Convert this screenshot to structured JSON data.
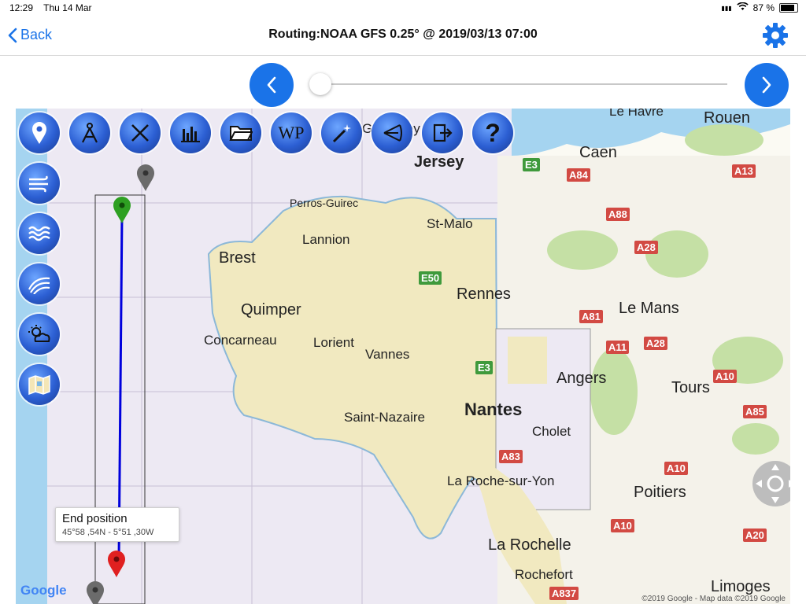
{
  "status": {
    "time": "12:29",
    "date": "Thu 14 Mar",
    "battery": "87 %",
    "battery_level": 0.87
  },
  "nav": {
    "back_label": "Back",
    "title": "Routing:NOAA GFS 0.25° @ 2019/03/13 07:00"
  },
  "timeline": {
    "slider_position": 0.0
  },
  "map": {
    "labels": {
      "le_havre": "Le Havre",
      "rouen": "Rouen",
      "caen": "Caen",
      "jersey": "Jersey",
      "guernsey": "Guernsey",
      "perros": "Perros-Guirec",
      "st_malo": "St-Malo",
      "lannion": "Lannion",
      "brest": "Brest",
      "rennes": "Rennes",
      "le_mans": "Le Mans",
      "quimper": "Quimper",
      "concarneau": "Concarneau",
      "lorient": "Lorient",
      "vannes": "Vannes",
      "angers": "Angers",
      "tours": "Tours",
      "saint_nazaire": "Saint-Nazaire",
      "nantes": "Nantes",
      "cholet": "Cholet",
      "roche_yon": "La Roche-sur-Yon",
      "poitiers": "Poitiers",
      "rochelle": "La Rochelle",
      "rochefort": "Rochefort",
      "limoges": "Limoges"
    },
    "roads": {
      "e3a": "E3",
      "a84": "A84",
      "a13": "A13",
      "a88": "A88",
      "a28a": "A28",
      "e50": "E50",
      "a81": "A81",
      "a11": "A11",
      "a28b": "A28",
      "e3b": "E3",
      "a10a": "A10",
      "a85": "A85",
      "a83": "A83",
      "a10b": "A10",
      "a10c": "A10",
      "a20": "A20",
      "a837": "A837"
    },
    "popup": {
      "title": "End position",
      "coords": "45°58 ,54N - 5°51 ,30W"
    },
    "google": "Google",
    "copyright": "©2019 Google - Map data ©2019 Google"
  },
  "colors": {
    "accent": "#1a73e8",
    "sea": "#a5d4f0",
    "land": "#f1e9c0",
    "route": "#0000dd"
  }
}
